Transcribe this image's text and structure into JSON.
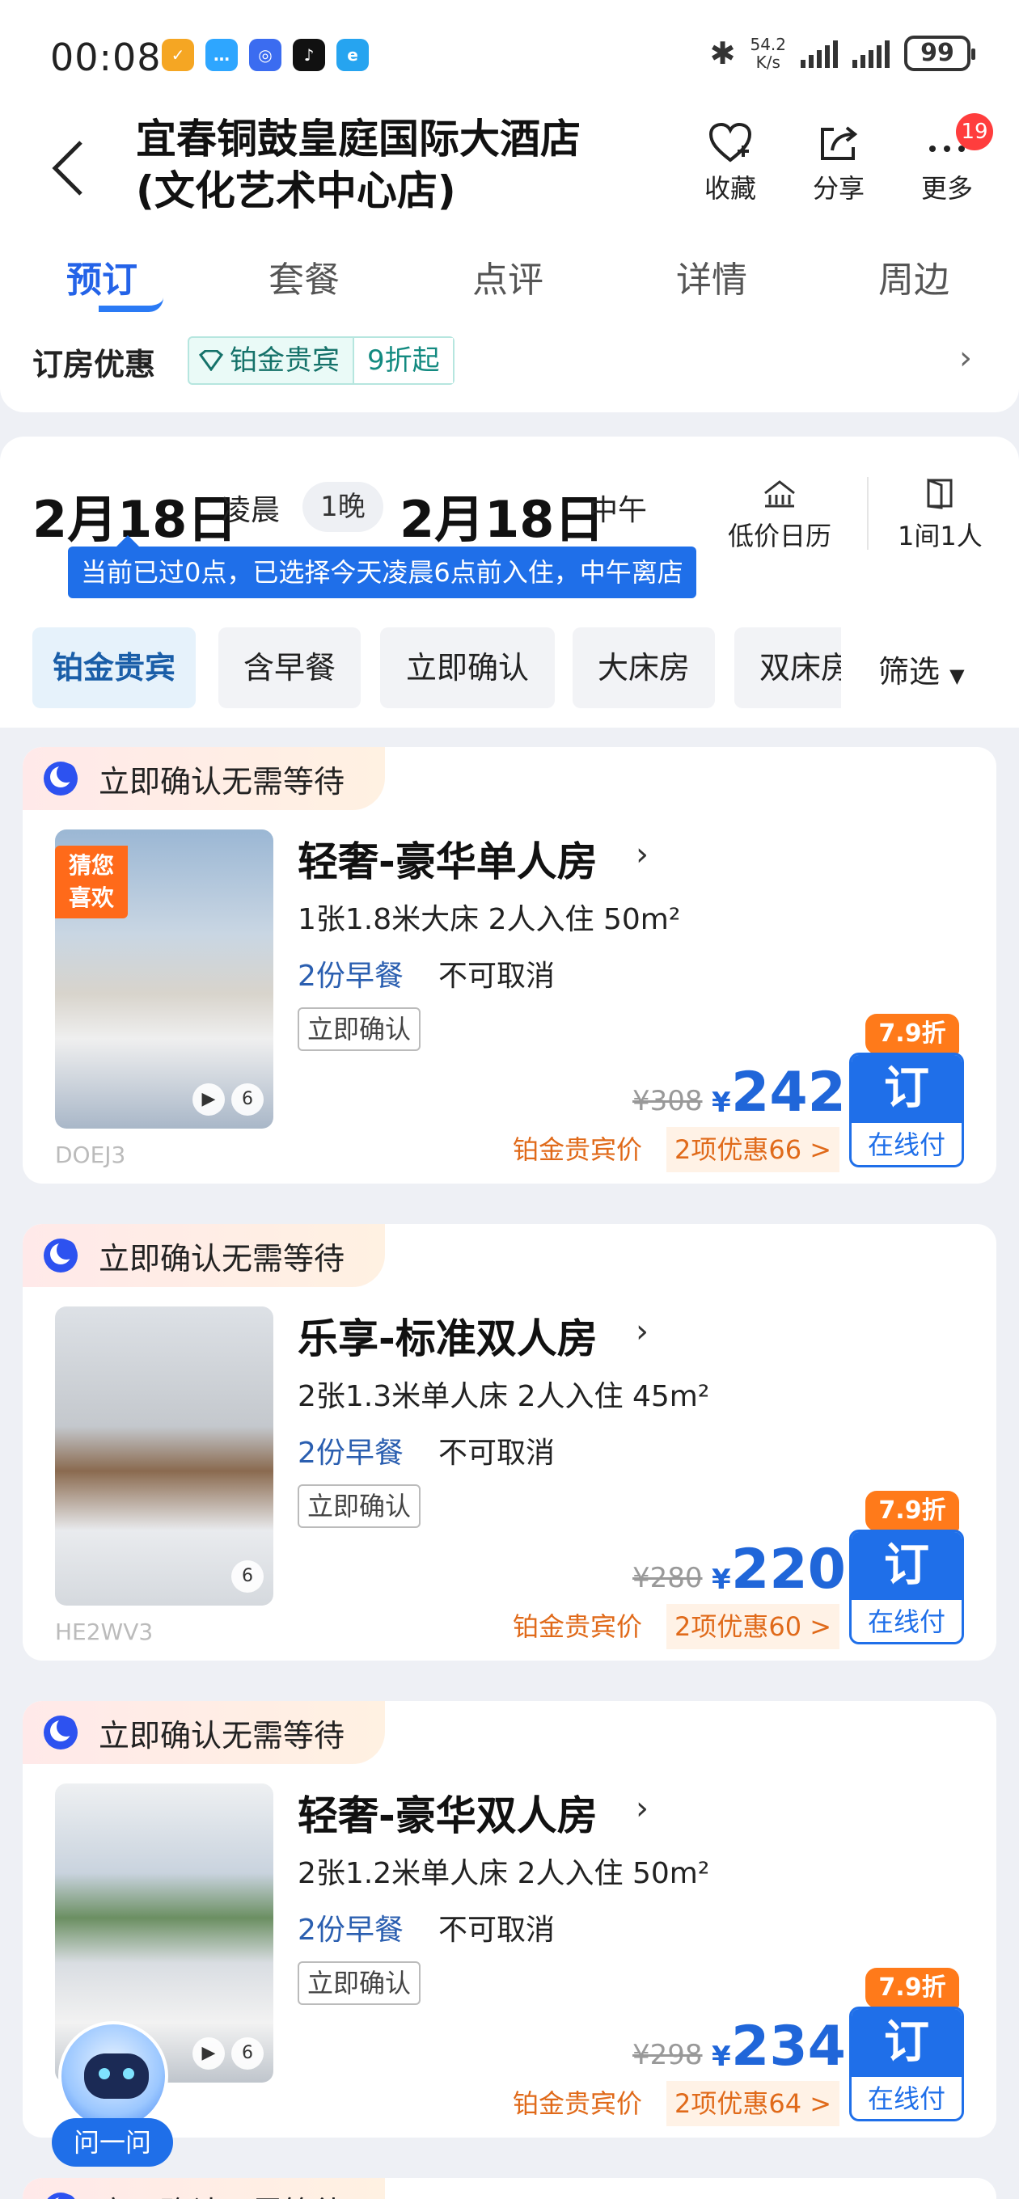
{
  "status_bar": {
    "time": "00:08",
    "speed_top": "54.2",
    "speed_bottom": "K/s",
    "battery": "99"
  },
  "header": {
    "title_line1": "宜春铜鼓皇庭国际大酒店",
    "title_line2": "(文化艺术中心店)",
    "favorite_label": "收藏",
    "share_label": "分享",
    "more_label": "更多",
    "more_badge": "19"
  },
  "tabs": [
    "预订",
    "套餐",
    "点评",
    "详情",
    "周边"
  ],
  "promo": {
    "label": "订房优惠",
    "tag_name": "铂金贵宾",
    "tag_discount": "9折起"
  },
  "booking": {
    "checkin_date": "2月18日",
    "checkin_time": "凌晨",
    "nights": "1晚",
    "checkout_date": "2月18日",
    "checkout_time": "中午",
    "low_price_calendar": "低价日历",
    "rooms_guests": "1间1人",
    "tip": "当前已过0点，已选择今天凌晨6点前入住，中午离店"
  },
  "filters": [
    "铂金贵宾",
    "含早餐",
    "立即确认",
    "大床房",
    "双床房"
  ],
  "filter_select": "筛选",
  "rooms": [
    {
      "instant": "立即确认无需等待",
      "name": "轻奢-豪华单人房",
      "bed_info": "1张1.8米大床   2人入住   50m²",
      "breakfast": "2份早餐",
      "cancel": "不可取消",
      "confirm_tag": "立即确认",
      "original_price": "¥308",
      "currency": "¥",
      "price": "242",
      "member_label": "铂金贵宾价",
      "offers": "2项优惠66 >",
      "discount": "7.9折",
      "book_label": "订",
      "book_sub": "在线付",
      "photo_count": "6",
      "code": "DOEJ3",
      "guess_label": "猜您喜欢"
    },
    {
      "instant": "立即确认无需等待",
      "name": "乐享-标准双人房",
      "bed_info": "2张1.3米单人床   2人入住   45m²",
      "breakfast": "2份早餐",
      "cancel": "不可取消",
      "confirm_tag": "立即确认",
      "original_price": "¥280",
      "currency": "¥",
      "price": "220",
      "member_label": "铂金贵宾价",
      "offers": "2项优惠60 >",
      "discount": "7.9折",
      "book_label": "订",
      "book_sub": "在线付",
      "photo_count": "6",
      "code": "HE2WV3"
    },
    {
      "instant": "立即确认无需等待",
      "name": "轻奢-豪华双人房",
      "bed_info": "2张1.2米单人床   2人入住   50m²",
      "breakfast": "2份早餐",
      "cancel": "不可取消",
      "confirm_tag": "立即确认",
      "original_price": "¥298",
      "currency": "¥",
      "price": "234",
      "member_label": "铂金贵宾价",
      "offers": "2项优惠64 >",
      "discount": "7.9折",
      "book_label": "订",
      "book_sub": "在线付",
      "photo_count": "6"
    }
  ],
  "assistant_label": "问一问",
  "next_card_instant": "立即确认无需等待",
  "colors": {
    "accent": "#1f6fe9",
    "orange": "#ff7a1a",
    "promo_green": "#138a80"
  }
}
